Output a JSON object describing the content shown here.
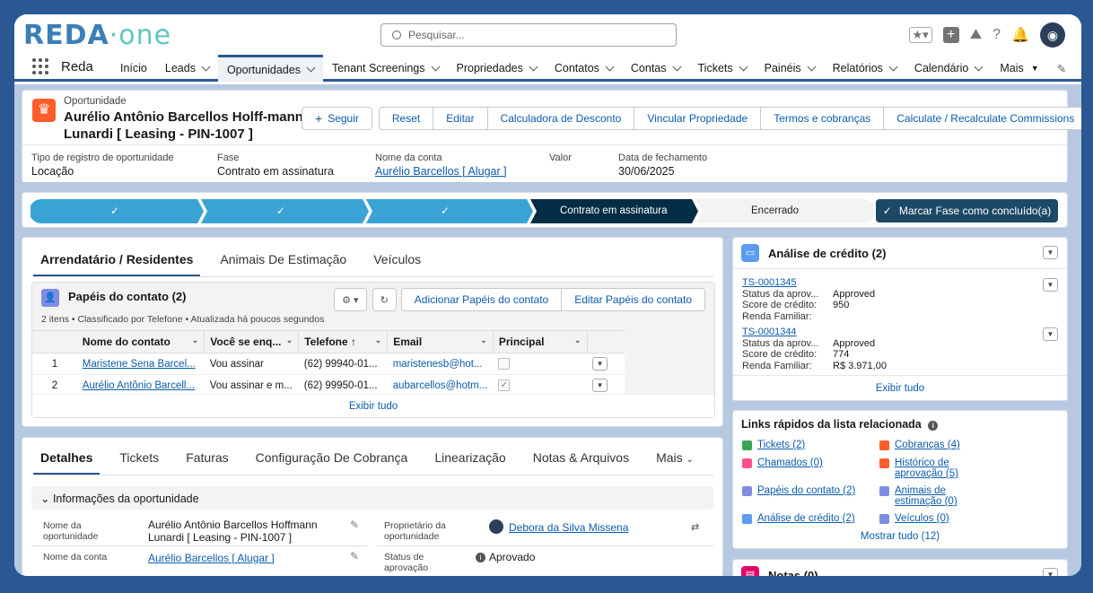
{
  "brand": {
    "logo_text": "REDA",
    "logo_dot": "·",
    "logo_suffix": "one"
  },
  "search": {
    "placeholder": "Pesquisar..."
  },
  "app_name": "Reda",
  "nav": [
    "Início",
    "Leads",
    "Oportunidades",
    "Tenant Screenings",
    "Propriedades",
    "Contatos",
    "Contas",
    "Tickets",
    "Painéis",
    "Relatórios",
    "Calendário",
    "Mais"
  ],
  "record": {
    "type_label": "Oportunidade",
    "name": "Aurélio Antônio Barcellos Holff-mann Lunardi [ Leasing - PIN-1007 ]",
    "buttons": {
      "follow": "Seguir",
      "reset": "Reset",
      "edit": "Editar",
      "discount": "Calculadora de Desconto",
      "link_property": "Vincular Propriedade",
      "terms": "Termos e cobranças",
      "commissions": "Calculate / Recalculate Commissions"
    },
    "fields": [
      {
        "label": "Tipo de registro de oportunidade",
        "value": "Locação"
      },
      {
        "label": "Fase",
        "value": "Contrato em assinatura"
      },
      {
        "label": "Nome da conta",
        "value": "Aurélio Barcellos [ Alugar ]"
      },
      {
        "label": "Valor",
        "value": ""
      },
      {
        "label": "Data de fechamento",
        "value": "30/06/2025"
      }
    ]
  },
  "path": {
    "current": "Contrato em assinatura",
    "next": "Encerrado",
    "button": "Marcar Fase como concluído(a)",
    "check": "✓"
  },
  "tabs1": [
    "Arrendatário / Residentes",
    "Animais De Estimação",
    "Veículos"
  ],
  "roles": {
    "title": "Papéis do contato (2)",
    "subtitle": "2 itens • Classificado por Telefone • Atualizada há poucos segundos",
    "add": "Adicionar Papéis do contato",
    "edit": "Editar Papéis do contato",
    "columns": [
      "Nome do contato",
      "Você se enq...",
      "Telefone ↑",
      "Email",
      "Principal"
    ],
    "rows": [
      {
        "n": "1",
        "name": "Maristene Sena Barcel...",
        "q": "Vou assinar",
        "phone": "(62) 99940-01...",
        "email": "maristenesb@hot...",
        "principal": ""
      },
      {
        "n": "2",
        "name": "Aurélio Antônio Barcell...",
        "q": "Vou assinar e m...",
        "phone": "(62) 99950-01...",
        "email": "aubarcellos@hotm...",
        "principal": "✓"
      }
    ],
    "view_all": "Exibir tudo"
  },
  "tabs2": [
    "Detalhes",
    "Tickets",
    "Faturas",
    "Configuração De Cobrança",
    "Linearização",
    "Notas & Arquivos",
    "Mais"
  ],
  "details": {
    "section": "Informações da oportunidade",
    "opp_name_label": "Nome da oportunidade",
    "opp_name": "Aurélio Antônio Barcellos Hoffmann Lunardi [ Leasing - PIN-1007 ]",
    "owner_label": "Proprietário da oportunidade",
    "owner": "Debora da Silva Missena",
    "account_label": "Nome da conta",
    "account": "Aurélio Barcellos [ Alugar ]",
    "approval_label": "Status de aprovação",
    "approval": "Aprovado"
  },
  "credit": {
    "title": "Análise de crédito (2)",
    "records": [
      {
        "id": "TS-0001345",
        "status_label": "Status da aprov...",
        "status": "Approved",
        "score_label": "Score de crédito:",
        "score": "950",
        "income_label": "Renda Familiar:",
        "income": ""
      },
      {
        "id": "TS-0001344",
        "status_label": "Status da aprov...",
        "status": "Approved",
        "score_label": "Score de crédito:",
        "score": "774",
        "income_label": "Renda Familiar:",
        "income": "R$ 3.971,00"
      }
    ],
    "view_all": "Exibir tudo"
  },
  "quicklinks": {
    "title": "Links rápidos da lista relacionada",
    "items": [
      {
        "label": "Tickets (2)",
        "color": "#3ba755"
      },
      {
        "label": "Cobranças (4)",
        "color": "#ff5d2d"
      },
      {
        "label": "Chamados (0)",
        "color": "#ff538a"
      },
      {
        "label": "Histórico de aprovação (5)",
        "color": "#ff5d2d"
      },
      {
        "label": "Papéis do contato (2)",
        "color": "#7f8de1"
      },
      {
        "label": "Animais de estimação (0)",
        "color": "#7f8de1"
      },
      {
        "label": "Análise de crédito (2)",
        "color": "#5b9bf2"
      },
      {
        "label": "Veículos (0)",
        "color": "#7f8de1"
      }
    ],
    "show_all": "Mostrar tudo (12)"
  },
  "notes": {
    "title": "Notas (0)"
  }
}
